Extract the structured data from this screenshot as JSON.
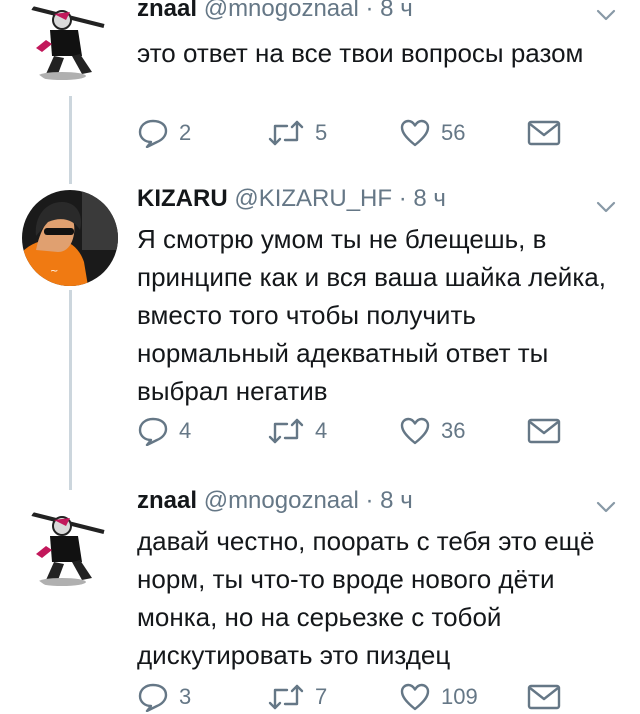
{
  "tweets": [
    {
      "name": "znaal",
      "handle": "@mnogoznaal",
      "dot": "·",
      "time": "8 ч",
      "text": "это ответ на все твои вопросы разом",
      "replies": "2",
      "retweets": "5",
      "likes": "56",
      "avatar_icon": "ninja-avatar-icon"
    },
    {
      "name": "KIZARU",
      "handle": "@KIZARU_HF",
      "dot": "·",
      "time": "8 ч",
      "text": "Я смотрю умом ты не блещешь, в принципе как и вся ваша шайка лейка, вместо того чтобы получить нормальный адекватный ответ ты выбрал негатив",
      "replies": "4",
      "retweets": "4",
      "likes": "36",
      "avatar_icon": "person-photo-avatar"
    },
    {
      "name": "znaal",
      "handle": "@mnogoznaal",
      "dot": "·",
      "time": "8 ч",
      "text": "давай честно, поорать с тебя это ещё норм, ты что-то вроде нового дёти монка, но на серьезке с тобой дискутировать это пиздец",
      "replies": "3",
      "retweets": "7",
      "likes": "109",
      "avatar_icon": "ninja-avatar-icon"
    }
  ],
  "colors": {
    "text": "#14171a",
    "muted": "#657786",
    "thread_line": "#ccd6dd"
  }
}
